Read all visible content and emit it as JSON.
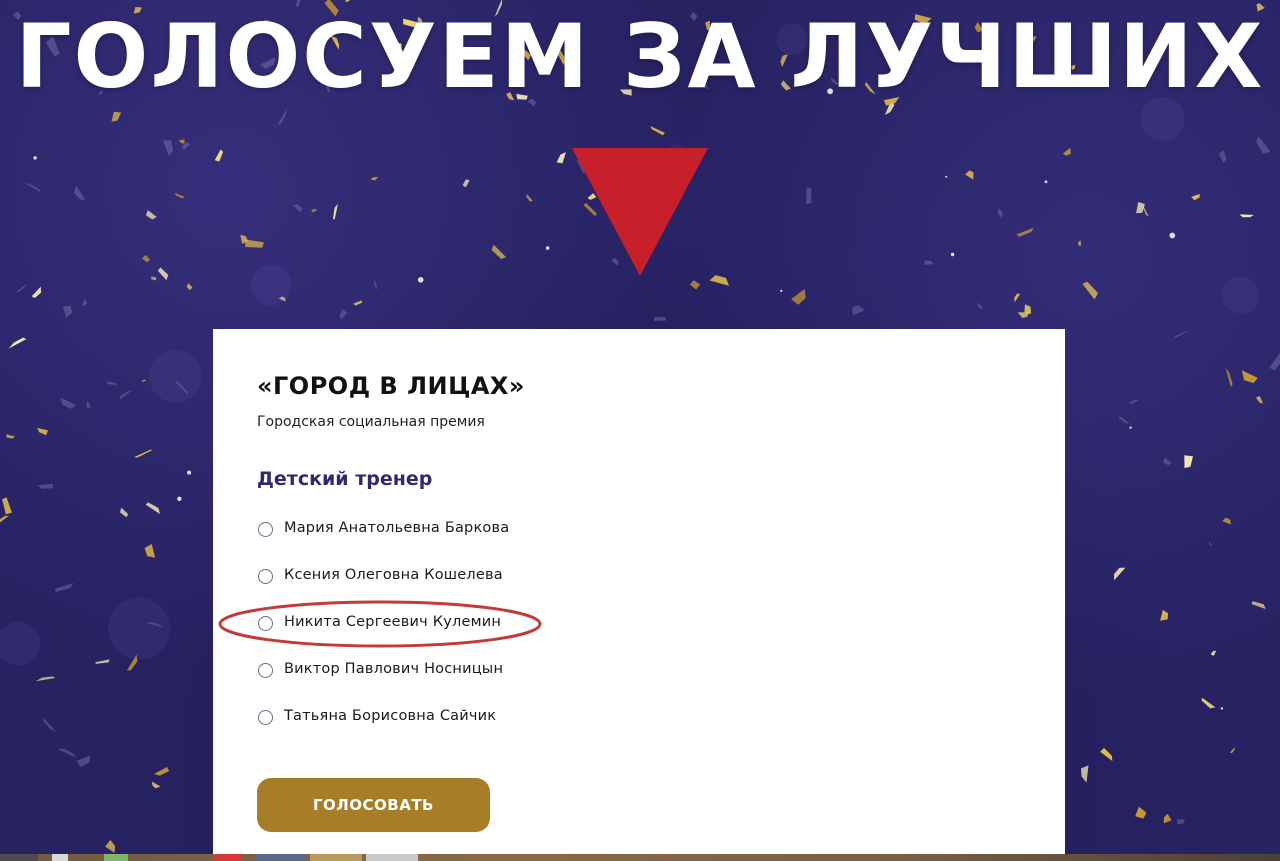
{
  "banner": {
    "headline": "ГОЛОСУЕМ ЗА ЛУЧШИХ"
  },
  "colors": {
    "background": "#272262",
    "arrow": "#c8202a",
    "confetti_gold": "#e8c24a",
    "category_text": "#2e2a6b",
    "button": "#a87d28",
    "highlight_ellipse": "#c23a3a"
  },
  "icons": {
    "arrow": "down-triangle-icon",
    "radio": "radio-circle-icon"
  },
  "poll": {
    "title": "«ГОРОД В ЛИЦАХ»",
    "subtitle": "Городская социальная премия",
    "category": "Детский тренер",
    "options": [
      {
        "label": "Мария Анатольевна Баркова",
        "selected": false
      },
      {
        "label": "Ксения Олеговна Кошелева",
        "selected": false
      },
      {
        "label": "Никита Сергеевич Кулемин",
        "selected": false,
        "highlighted": true
      },
      {
        "label": "Виктор Павлович Носницын",
        "selected": false
      },
      {
        "label": "Татьяна Борисовна Сайчик",
        "selected": false
      }
    ],
    "vote_button": "ГОЛОСОВАТЬ"
  }
}
